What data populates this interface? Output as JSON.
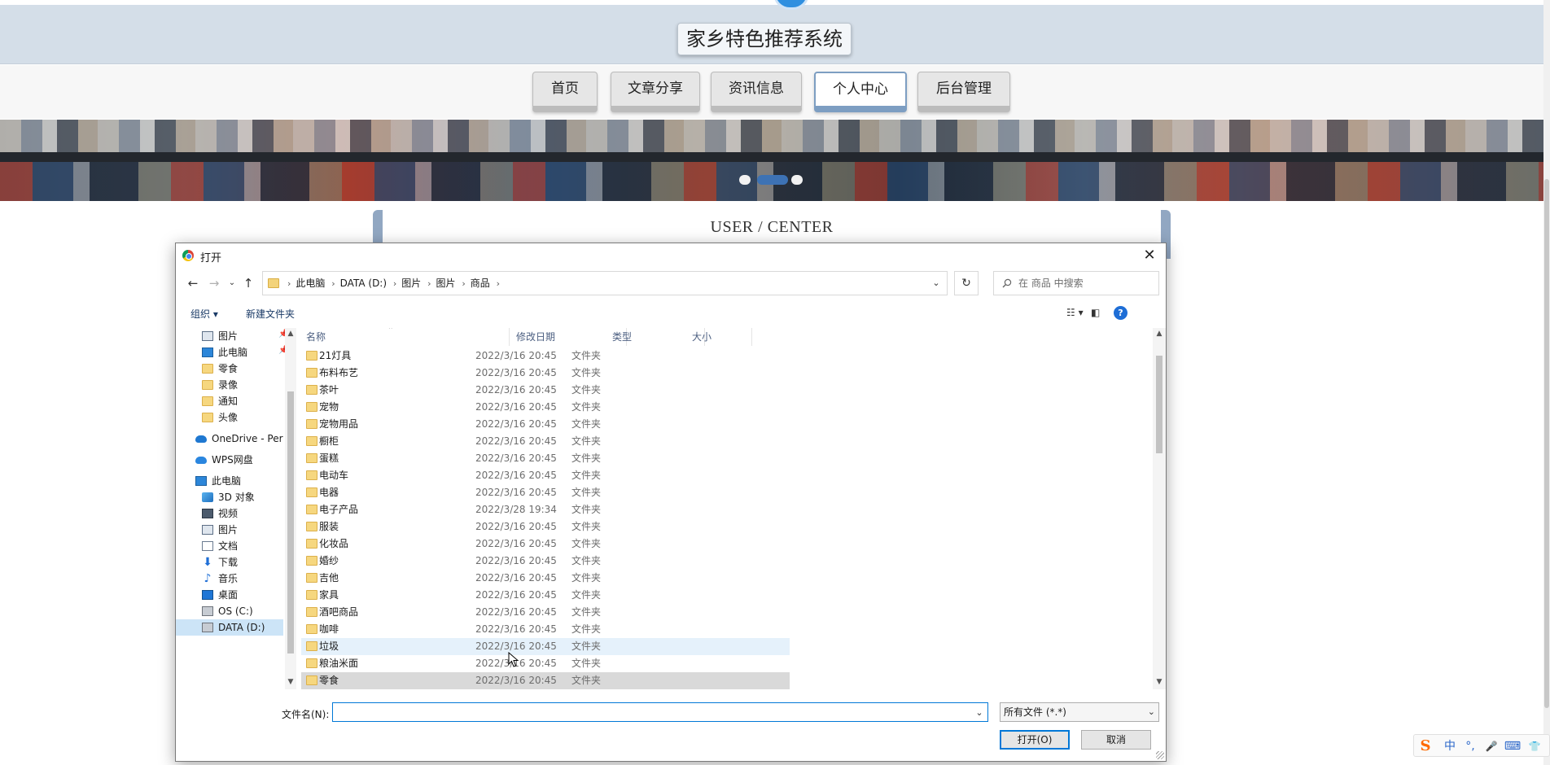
{
  "site": {
    "title": "家乡特色推荐系统",
    "nav": [
      {
        "label": "首页",
        "active": false
      },
      {
        "label": "文章分享",
        "active": false
      },
      {
        "label": "资讯信息",
        "active": false
      },
      {
        "label": "个人中心",
        "active": true
      },
      {
        "label": "后台管理",
        "active": false
      }
    ],
    "content_heading": "USER / CENTER"
  },
  "dialog": {
    "title": "打开",
    "close_glyph": "✕",
    "address": {
      "crumbs": [
        "此电脑",
        "DATA (D:)",
        "图片",
        "图片",
        "商品"
      ]
    },
    "search": {
      "placeholder": "在 商品 中搜索"
    },
    "toolbar": {
      "organize": "组织 ▾",
      "new_folder": "新建文件夹",
      "help": "?"
    },
    "nav_pane": [
      {
        "label": "图片",
        "icon": "pictures-icon",
        "pinned": true
      },
      {
        "label": "此电脑",
        "icon": "computer-icon",
        "pinned": true
      },
      {
        "label": "零食",
        "icon": "folder-icon"
      },
      {
        "label": "录像",
        "icon": "folder-icon"
      },
      {
        "label": "通知",
        "icon": "folder-icon"
      },
      {
        "label": "头像",
        "icon": "folder-icon"
      },
      {
        "label": "OneDrive - Pers",
        "icon": "onedrive-icon"
      },
      {
        "label": "WPS网盘",
        "icon": "wps-cloud-icon"
      },
      {
        "label": "此电脑",
        "icon": "computer-icon"
      },
      {
        "label": "3D 对象",
        "icon": "3d-objects-icon"
      },
      {
        "label": "视频",
        "icon": "video-icon"
      },
      {
        "label": "图片",
        "icon": "pictures-icon"
      },
      {
        "label": "文档",
        "icon": "documents-icon"
      },
      {
        "label": "下载",
        "icon": "download-icon"
      },
      {
        "label": "音乐",
        "icon": "music-icon"
      },
      {
        "label": "桌面",
        "icon": "desktop-icon"
      },
      {
        "label": "OS (C:)",
        "icon": "drive-icon"
      },
      {
        "label": "DATA (D:)",
        "icon": "drive-icon",
        "selected": true
      }
    ],
    "columns": {
      "name": "名称",
      "date": "修改日期",
      "type": "类型",
      "size": "大小"
    },
    "files": [
      {
        "name": "21灯具",
        "date": "2022/3/16 20:45",
        "type": "文件夹"
      },
      {
        "name": "布料布艺",
        "date": "2022/3/16 20:45",
        "type": "文件夹"
      },
      {
        "name": "茶叶",
        "date": "2022/3/16 20:45",
        "type": "文件夹"
      },
      {
        "name": "宠物",
        "date": "2022/3/16 20:45",
        "type": "文件夹"
      },
      {
        "name": "宠物用品",
        "date": "2022/3/16 20:45",
        "type": "文件夹"
      },
      {
        "name": "橱柜",
        "date": "2022/3/16 20:45",
        "type": "文件夹"
      },
      {
        "name": "蛋糕",
        "date": "2022/3/16 20:45",
        "type": "文件夹"
      },
      {
        "name": "电动车",
        "date": "2022/3/16 20:45",
        "type": "文件夹"
      },
      {
        "name": "电器",
        "date": "2022/3/16 20:45",
        "type": "文件夹"
      },
      {
        "name": "电子产品",
        "date": "2022/3/28 19:34",
        "type": "文件夹"
      },
      {
        "name": "服装",
        "date": "2022/3/16 20:45",
        "type": "文件夹"
      },
      {
        "name": "化妆品",
        "date": "2022/3/16 20:45",
        "type": "文件夹"
      },
      {
        "name": "婚纱",
        "date": "2022/3/16 20:45",
        "type": "文件夹"
      },
      {
        "name": "吉他",
        "date": "2022/3/16 20:45",
        "type": "文件夹"
      },
      {
        "name": "家具",
        "date": "2022/3/16 20:45",
        "type": "文件夹"
      },
      {
        "name": "酒吧商品",
        "date": "2022/3/16 20:45",
        "type": "文件夹"
      },
      {
        "name": "咖啡",
        "date": "2022/3/16 20:45",
        "type": "文件夹"
      },
      {
        "name": "垃圾",
        "date": "2022/3/16 20:45",
        "type": "文件夹",
        "state": "hover"
      },
      {
        "name": "粮油米面",
        "date": "2022/3/16 20:45",
        "type": "文件夹"
      },
      {
        "name": "零食",
        "date": "2022/3/16 20:45",
        "type": "文件夹",
        "state": "selected"
      }
    ],
    "filename_label": "文件名(N):",
    "filename_value": "",
    "filter": "所有文件 (*.*)",
    "open_label": "打开(O)",
    "cancel_label": "取消"
  },
  "ime": {
    "logo": "S",
    "items": [
      "中",
      "°,",
      "🎤",
      "⌨",
      "👕"
    ]
  }
}
